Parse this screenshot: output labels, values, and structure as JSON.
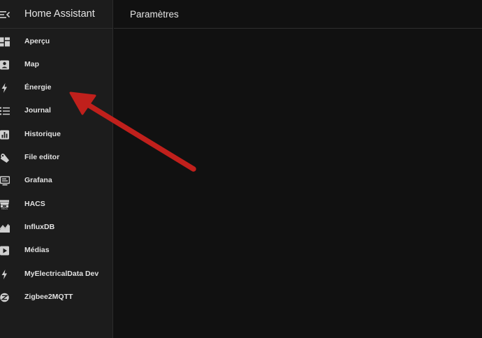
{
  "app": {
    "title": "Home Assistant"
  },
  "header": {
    "page_title": "Paramètres"
  },
  "sidebar": {
    "items": [
      {
        "label": "Aperçu",
        "icon": "dashboard-icon"
      },
      {
        "label": "Map",
        "icon": "map-account-icon"
      },
      {
        "label": "Énergie",
        "icon": "lightning-bolt-icon"
      },
      {
        "label": "Journal",
        "icon": "format-list-bulleted-icon"
      },
      {
        "label": "Historique",
        "icon": "chart-box-icon"
      },
      {
        "label": "File editor",
        "icon": "wrench-icon"
      },
      {
        "label": "Grafana",
        "icon": "monitor-dashboard-icon"
      },
      {
        "label": "HACS",
        "icon": "hacs-store-icon"
      },
      {
        "label": "InfluxDB",
        "icon": "chart-areaspline-icon"
      },
      {
        "label": "Médias",
        "icon": "play-box-icon"
      },
      {
        "label": "MyElectricalData Dev",
        "icon": "lightning-bolt-icon"
      },
      {
        "label": "Zigbee2MQTT",
        "icon": "zigbee-icon"
      }
    ]
  },
  "colors": {
    "sidebar_bg": "#1c1c1c",
    "main_bg": "#111111",
    "text": "#e1e1e1",
    "annotation_arrow": "#c0201c"
  }
}
